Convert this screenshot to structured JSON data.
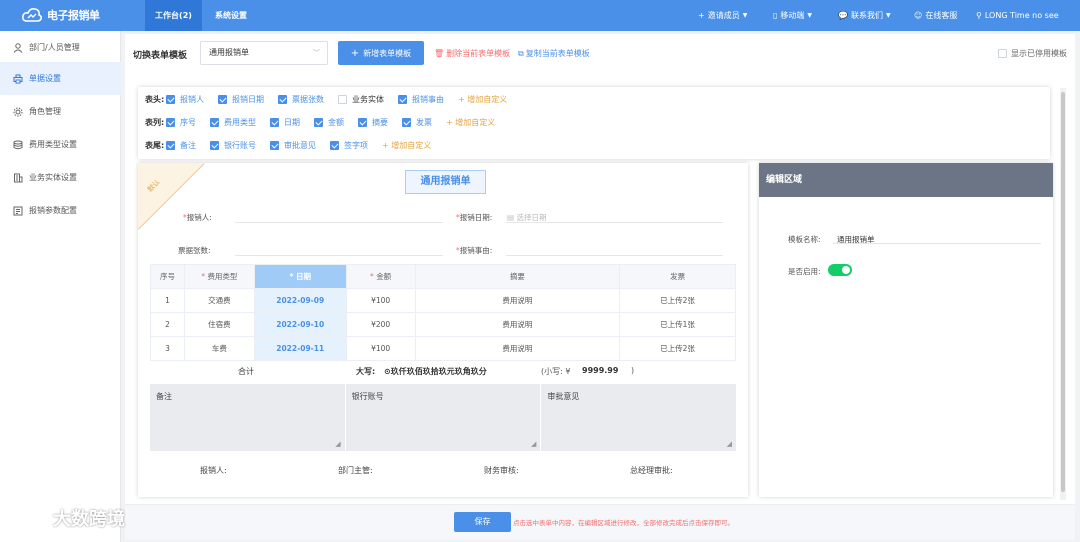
{
  "app": {
    "name": "电子报销单"
  },
  "nav": {
    "tabs": [
      {
        "label": "工作台(2)"
      },
      {
        "label": "系统设置"
      }
    ],
    "right": {
      "invite": "邀请成员",
      "mobile": "移动端",
      "contact": "联系我们",
      "service": "在线客服",
      "user": "LONG Time no see"
    }
  },
  "sidebar": {
    "items": [
      {
        "label": "部门/人员管理",
        "icon": "user-icon"
      },
      {
        "label": "单据设置",
        "icon": "print-icon",
        "active": true
      },
      {
        "label": "角色管理",
        "icon": "gear-icon"
      },
      {
        "label": "费用类型设置",
        "icon": "stack-icon"
      },
      {
        "label": "业务实体设置",
        "icon": "building-icon"
      },
      {
        "label": "报销参数配置",
        "icon": "config-icon"
      }
    ]
  },
  "toolbar": {
    "title": "切换表单模板",
    "template_value": "通用报销单",
    "new_button": "新增表单模板",
    "delete_link": "删除当前表单模板",
    "copy_link": "复制当前表单模板",
    "show_disabled": "显示已停用模板",
    "colors": {
      "accent": "#4a90e8",
      "danger": "#f56c6c"
    }
  },
  "fields": {
    "header": {
      "label": "表头:",
      "items": [
        {
          "text": "报销人",
          "checked": true
        },
        {
          "text": "报销日期",
          "checked": true
        },
        {
          "text": "票据张数",
          "checked": true
        },
        {
          "text": "业务实体",
          "checked": false
        },
        {
          "text": "报销事由",
          "checked": true
        }
      ],
      "add": "增加自定义"
    },
    "columns": {
      "label": "表列:",
      "items": [
        {
          "text": "序号",
          "checked": true
        },
        {
          "text": "费用类型",
          "checked": true
        },
        {
          "text": "日期",
          "checked": true
        },
        {
          "text": "金额",
          "checked": true
        },
        {
          "text": "摘要",
          "checked": true
        },
        {
          "text": "发票",
          "checked": true
        }
      ],
      "add": "增加自定义"
    },
    "footer": {
      "label": "表尾:",
      "items": [
        {
          "text": "备注",
          "checked": true
        },
        {
          "text": "银行账号",
          "checked": true
        },
        {
          "text": "审批意见",
          "checked": true
        },
        {
          "text": "签字项",
          "checked": true
        }
      ],
      "add": "增加自定义"
    }
  },
  "doc": {
    "ribbon": "默认",
    "title": "通用报销单",
    "reimburser_label": "报销人:",
    "date_label": "报销日期:",
    "date_placeholder": "选择日期",
    "ticket_label": "票据张数:",
    "reason_label": "报销事由:",
    "table": {
      "headers": [
        "序号",
        "费用类型",
        "日期",
        "金额",
        "摘要",
        "发票"
      ],
      "rows": [
        [
          "1",
          "交通费",
          "2022-09-09",
          "¥100",
          "费用说明",
          "已上传2张"
        ],
        [
          "2",
          "住宿费",
          "2022-09-10",
          "¥200",
          "费用说明",
          "已上传1张"
        ],
        [
          "3",
          "车费",
          "2022-09-11",
          "¥100",
          "费用说明",
          "已上传2张"
        ]
      ]
    },
    "total_label": "合计",
    "daxie_label": "大写:",
    "daxie_value": "⊙玖仟玖佰玖拾玖元玖角玖分",
    "xiaoxie_label": "(小写: ¥",
    "xiaoxie_value": "9999.99",
    "xiaoxie_close": ")",
    "notes": [
      "备注",
      "银行账号",
      "审批意见"
    ],
    "signatures": [
      "报销人:",
      "部门主管:",
      "财务审核:",
      "总经理审批:"
    ]
  },
  "edit_panel": {
    "title": "编辑区域",
    "name_label": "模板名称:",
    "name_value": "通用报销单",
    "enabled_label": "是否启用:",
    "enabled": true
  },
  "save": {
    "button": "保存",
    "hint": "点击选中表单中内容，在编辑区域进行修改，全部修改完成后点击保存即可。"
  },
  "watermark": "大数跨境"
}
